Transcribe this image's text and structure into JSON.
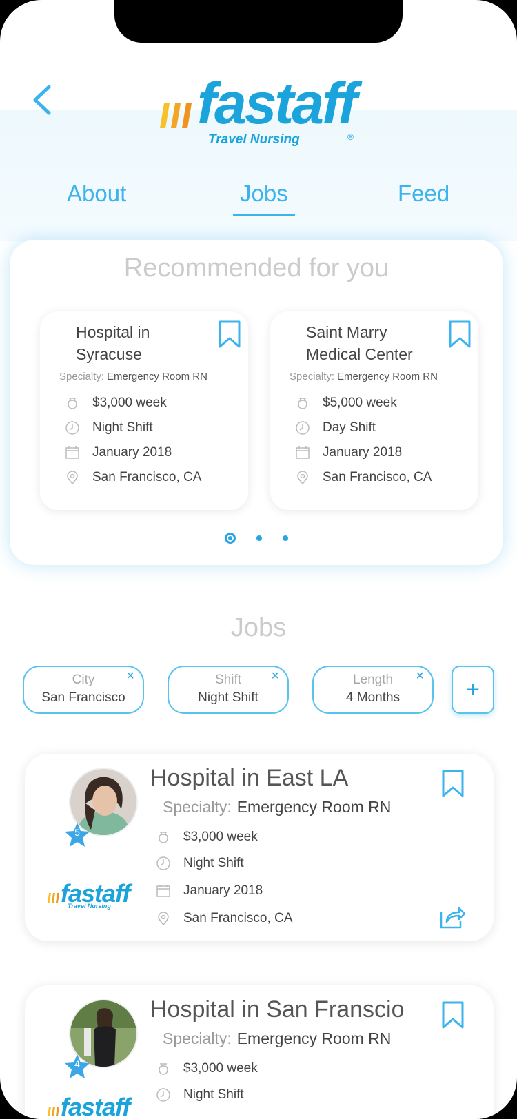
{
  "header": {
    "logo_word": "fastaff",
    "logo_tagline": "Travel Nursing",
    "logo_reg": "®",
    "back_icon": "chevron-left-icon"
  },
  "tabs": [
    {
      "label": "About"
    },
    {
      "label": "Jobs"
    },
    {
      "label": "Feed"
    }
  ],
  "active_tab": "Jobs",
  "recommended": {
    "title": "Recommended for you",
    "cards": [
      {
        "name_line1": "Hospital in",
        "name_line2": "Syracuse",
        "specialty_label": "Specialty:",
        "specialty": "Emergency Room RN",
        "pay": "$3,000 week",
        "shift": "Night Shift",
        "date": "January 2018",
        "location": "San Francisco, CA"
      },
      {
        "name_line1": "Saint Marry",
        "name_line2": "Medical Center",
        "specialty_label": "Specialty:",
        "specialty": "Emergency Room RN",
        "pay": "$5,000 week",
        "shift": "Day Shift",
        "date": "January 2018",
        "location": "San Francisco, CA"
      }
    ],
    "page_count": 3,
    "active_page": 1
  },
  "jobs": {
    "title": "Jobs",
    "filters": [
      {
        "key": "City",
        "value": "San Francisco",
        "remove": "×"
      },
      {
        "key": "Shift",
        "value": "Night Shift",
        "remove": "×"
      },
      {
        "key": "Length",
        "value": "4 Months",
        "remove": "×"
      }
    ],
    "add_filter": "+",
    "listings": [
      {
        "title": "Hospital in East LA",
        "specialty_label": "Specialty:",
        "specialty": "Emergency Room RN",
        "rating": "5",
        "pay": "$3,000 week",
        "shift": "Night Shift",
        "date": "January 2018",
        "location": "San Francisco, CA",
        "logo_word": "fastaff",
        "logo_tagline": "Travel Nursing"
      },
      {
        "title": "Hospital in San Franscio",
        "specialty_label": "Specialty:",
        "specialty": "Emergency Room RN",
        "rating": "4",
        "pay": "$3,000 week",
        "shift": "Night Shift",
        "logo_word": "fastaff"
      }
    ]
  },
  "colors": {
    "accent": "#3bb3ec",
    "brand_blue": "#1ba3dc",
    "brand_yellow": "#f6c12a",
    "brand_orange": "#f0931f",
    "heading_gray": "#cbcbcb"
  }
}
